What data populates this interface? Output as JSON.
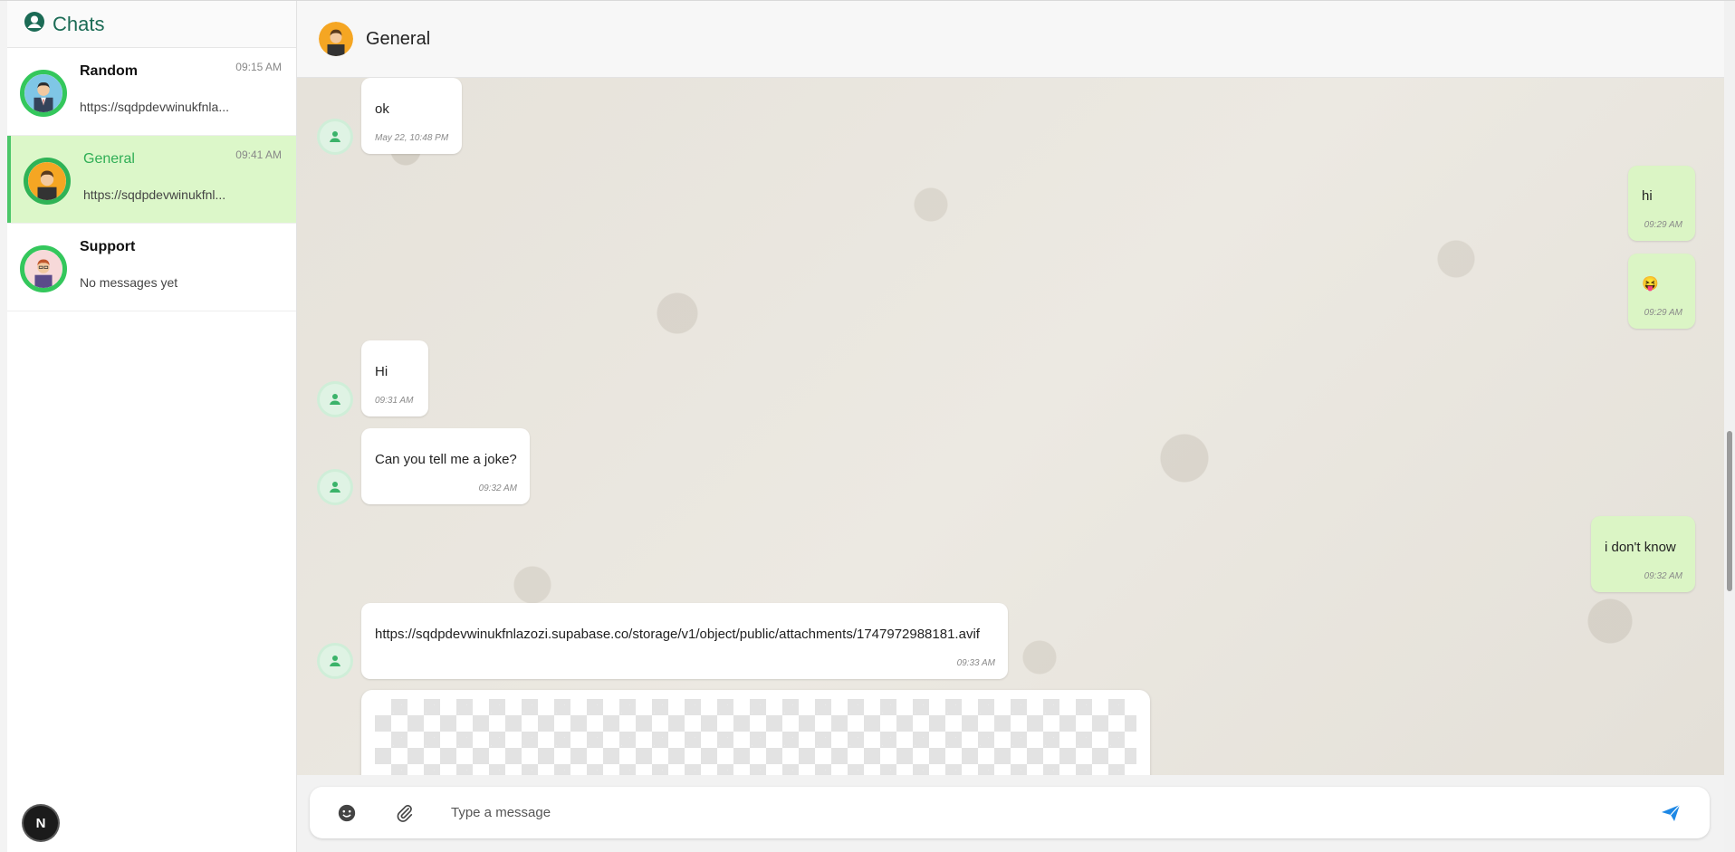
{
  "sidebar": {
    "title": "Chats",
    "chats": [
      {
        "name": "Random",
        "time": "09:15 AM",
        "preview": "https://sqdpdevwinukfnla..."
      },
      {
        "name": "General",
        "time": "09:41 AM",
        "preview": "https://sqdpdevwinukfnl..."
      },
      {
        "name": "Support",
        "time": "",
        "preview": "No messages yet"
      }
    ],
    "badge": "N"
  },
  "header": {
    "title": "General"
  },
  "messages": [
    {
      "text": "ok",
      "time": "May 22, 10:48 PM",
      "direction": "in"
    },
    {
      "text": "hi",
      "time": "09:29 AM",
      "direction": "out"
    },
    {
      "text": "😝",
      "time": "09:29 AM",
      "direction": "out"
    },
    {
      "text": "Hi",
      "time": "09:31 AM",
      "direction": "in"
    },
    {
      "text": "Can you tell me a joke?",
      "time": "09:32 AM",
      "direction": "in"
    },
    {
      "text": "i don't know",
      "time": "09:32 AM",
      "direction": "out"
    },
    {
      "text": "https://sqdpdevwinukfnlazozi.supabase.co/storage/v1/object/public/attachments/1747972988181.avif",
      "time": "09:33 AM",
      "direction": "in"
    }
  ],
  "composer": {
    "placeholder": "Type a message"
  },
  "colors": {
    "accent": "#34c75c",
    "outgoing": "#dbf5c5",
    "active_chat": "#dcf7c9",
    "send": "#1e88e5"
  },
  "icons": [
    "user-circle-icon",
    "user-icon",
    "smile-icon",
    "paperclip-icon",
    "send-icon"
  ]
}
